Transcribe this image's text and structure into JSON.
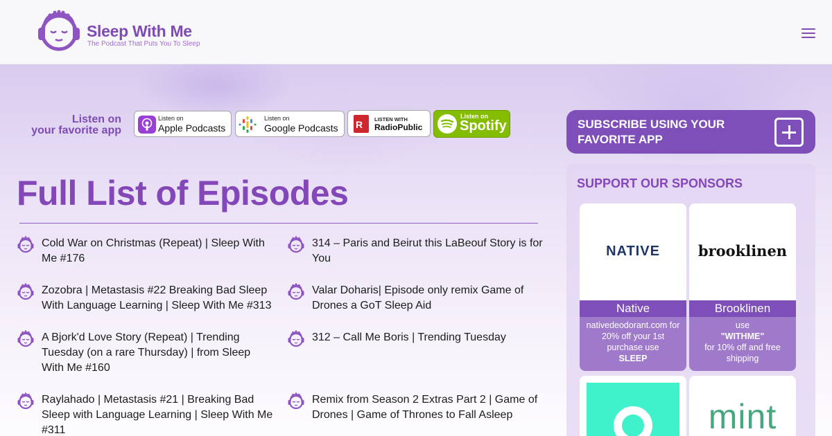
{
  "header": {
    "logo_title": "Sleep With Me",
    "logo_tagline": "The Podcast That Puts You To Sleep"
  },
  "listen": {
    "line1": "Listen on",
    "line2": "your favorite app",
    "badges": {
      "apple": {
        "small": "Listen on",
        "big": "Apple Podcasts"
      },
      "google": {
        "small": "Listen on",
        "big": "Google Podcasts"
      },
      "radiopublic": {
        "small": "LISTEN WITH",
        "big": "RadioPublic"
      },
      "spotify": {
        "small": "Listen on",
        "big": "Spotify"
      }
    }
  },
  "main": {
    "title": "Full List of Episodes",
    "episodes": [
      {
        "title": "Cold War on Christmas (Repeat) | Sleep With Me #176"
      },
      {
        "title": "314 – Paris and Beirut this LaBeouf Story is for You"
      },
      {
        "title": "Zozobra | Metastasis #22 Breaking Bad Sleep With Language Learning | Sleep With Me #313"
      },
      {
        "title": "Valar Doharis| Episode only remix Game of Drones a GoT Sleep Aid"
      },
      {
        "title": "A Bjork'd Love Story (Repeat) | Trending Tuesday (on a rare Thursday) | from Sleep With Me #160"
      },
      {
        "title": "312 – Call Me Boris | Trending Tuesday"
      },
      {
        "title": "Raylahado | Metastasis #21 | Breaking Bad Sleep with Language Learning | Sleep With Me #311"
      },
      {
        "title": "Remix from Season 2 Extras Part 2 | Game of Drones | Game of Thrones to Fall Asleep"
      }
    ]
  },
  "sidebar": {
    "subscribe_label": "SUBSCRIBE USING YOUR FAVORITE APP",
    "sponsors_title": "SUPPORT OUR SPONSORS",
    "sponsors": [
      {
        "logo_text": "NATIVE",
        "name": "Native",
        "desc_line1": "nativedeodorant.com for 20% off your 1st purchase use",
        "desc_bold": "SLEEP",
        "desc_line2": ""
      },
      {
        "logo_text": "brooklinen",
        "name": "Brooklinen",
        "desc_line1": "use",
        "desc_bold": "\"WITHME\"",
        "desc_line2": "for 10% off and free shipping"
      },
      {
        "logo_text": "",
        "name": "",
        "desc_line1": "",
        "desc_bold": "",
        "desc_line2": ""
      },
      {
        "logo_text": "mint",
        "name": "",
        "desc_line1": "",
        "desc_bold": "",
        "desc_line2": ""
      }
    ]
  },
  "colors": {
    "brand_purple": "#7d4bb3",
    "title_purple": "#8347b8",
    "card_purple": "#7e4fb8",
    "card_desc_purple": "#9f7acb",
    "spotify_green": "#84bd00",
    "mint_green": "#47a77e",
    "teal": "#3ff2cc"
  },
  "icons": {
    "logo": "sleeping-face-headphones-icon",
    "menu": "hamburger-menu-icon",
    "episode": "sleeping-face-headphones-icon",
    "subscribe": "plus-square-icon"
  }
}
